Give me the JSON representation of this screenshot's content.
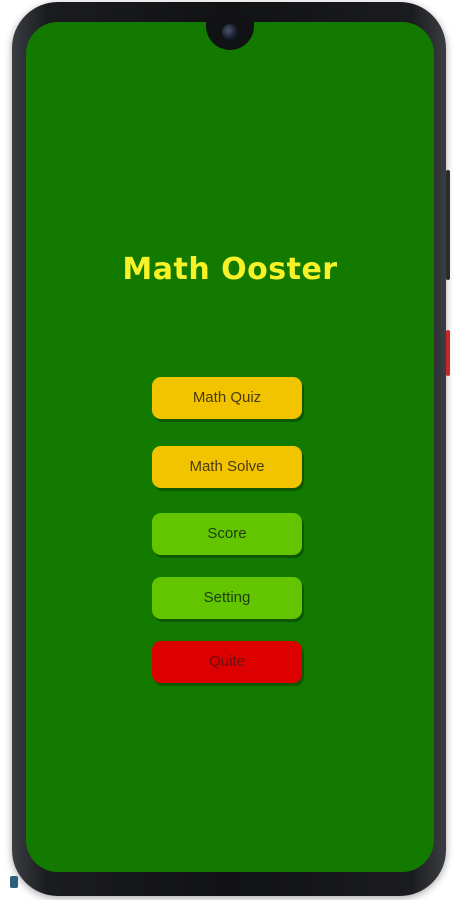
{
  "app": {
    "title": "Math Ooster"
  },
  "menu": {
    "buttons": [
      {
        "label": "Math Quiz",
        "color": "#f2c400"
      },
      {
        "label": "Math Solve",
        "color": "#f2c400"
      },
      {
        "label": "Score",
        "color": "#63c400"
      },
      {
        "label": "Setting",
        "color": "#63c400"
      },
      {
        "label": "Quite",
        "color": "#dd0000"
      }
    ]
  },
  "theme": {
    "background": "#137a00",
    "title_color": "#f6f227"
  }
}
